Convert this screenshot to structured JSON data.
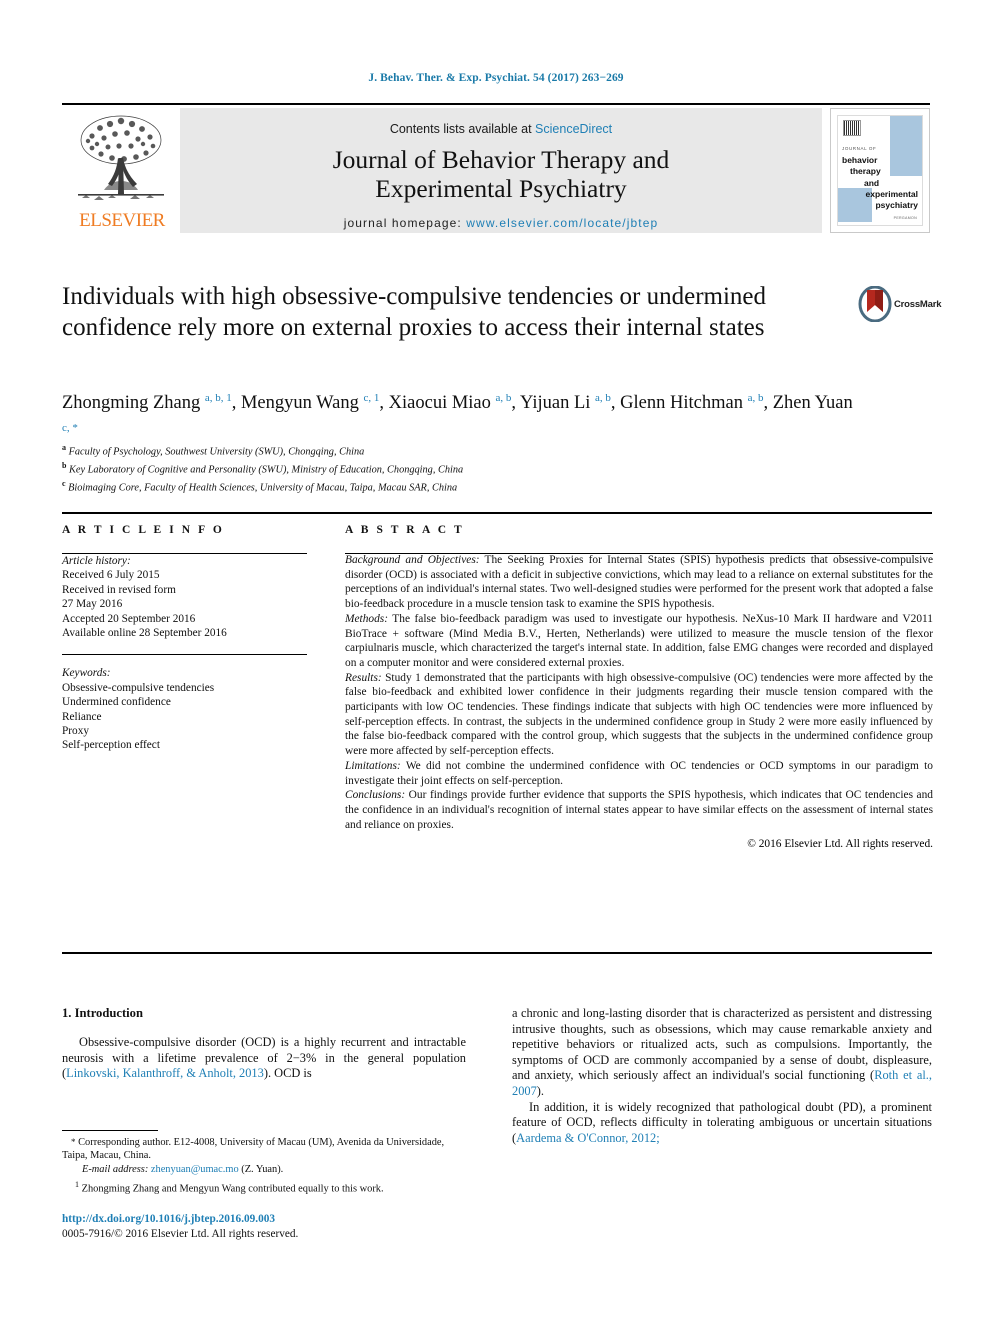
{
  "running_head": "J. Behav. Ther. & Exp. Psychiat. 54 (2017) 263−269",
  "masthead": {
    "contents_prefix": "Contents lists available at ",
    "contents_link": "ScienceDirect",
    "journal_title_line1": "Journal of Behavior Therapy and",
    "journal_title_line2": "Experimental Psychiatry",
    "homepage_prefix": "journal homepage: ",
    "homepage_link": "www.elsevier.com/locate/jbtep",
    "publisher": "ELSEVIER",
    "cover": {
      "journal_of": "JOURNAL OF",
      "line1": "behavior",
      "line2": "therapy",
      "line3": "and",
      "line4": "experimental",
      "line5": "psychiatry",
      "publisher_small": "PERGAMON"
    }
  },
  "article": {
    "title": "Individuals with high obsessive-compulsive tendencies or undermined confidence rely more on external proxies to access their internal states",
    "crossmark_label": "CrossMark",
    "authors": [
      {
        "name": "Zhongming Zhang",
        "marks": "a, b, 1",
        "sep": ", "
      },
      {
        "name": "Mengyun Wang",
        "marks": "c, 1",
        "sep": ", "
      },
      {
        "name": "Xiaocui Miao",
        "marks": "a, b",
        "sep": ", "
      },
      {
        "name": "Yijuan Li",
        "marks": "a, b",
        "sep": ", "
      },
      {
        "name": "Glenn Hitchman",
        "marks": "a, b",
        "sep": ", "
      },
      {
        "name": "Zhen Yuan",
        "marks": "c, *",
        "sep": ""
      }
    ],
    "affiliations": [
      {
        "mark": "a",
        "text": "Faculty of Psychology, Southwest University (SWU), Chongqing, China"
      },
      {
        "mark": "b",
        "text": "Key Laboratory of Cognitive and Personality (SWU), Ministry of Education, Chongqing, China"
      },
      {
        "mark": "c",
        "text": "Bioimaging Core, Faculty of Health Sciences, University of Macau, Taipa, Macau SAR, China"
      }
    ]
  },
  "article_info": {
    "heading": "A R T I C L E  I N F O",
    "history_label": "Article history:",
    "history": [
      "Received 6 July 2015",
      "Received in revised form",
      "27 May 2016",
      "Accepted 20 September 2016",
      "Available online 28 September 2016"
    ],
    "keywords_label": "Keywords:",
    "keywords": [
      "Obsessive-compulsive tendencies",
      "Undermined confidence",
      "Reliance",
      "Proxy",
      "Self-perception effect"
    ]
  },
  "abstract": {
    "heading": "A B S T R A C T",
    "paragraphs": [
      {
        "label": "Background and Objectives:",
        "text": " The Seeking Proxies for Internal States (SPIS) hypothesis predicts that obsessive-compulsive disorder (OCD) is associated with a deficit in subjective convictions, which may lead to a reliance on external substitutes for the perceptions of an individual's internal states. Two well-designed studies were performed for the present work that adopted a false bio-feedback procedure in a muscle tension task to examine the SPIS hypothesis."
      },
      {
        "label": "Methods:",
        "text": " The false bio-feedback paradigm was used to investigate our hypothesis. NeXus-10 Mark II hardware and V2011 BioTrace + software (Mind Media B.V., Herten, Netherlands) were utilized to measure the muscle tension of the flexor carpiulnaris muscle, which characterized the target's internal state. In addition, false EMG changes were recorded and displayed on a computer monitor and were considered external proxies."
      },
      {
        "label": "Results:",
        "text": " Study 1 demonstrated that the participants with high obsessive-compulsive (OC) tendencies were more affected by the false bio-feedback and exhibited lower confidence in their judgments regarding their muscle tension compared with the participants with low OC tendencies. These findings indicate that subjects with high OC tendencies were more influenced by self-perception effects. In contrast, the subjects in the undermined confidence group in Study 2 were more easily influenced by the false bio-feedback compared with the control group, which suggests that the subjects in the undermined confidence group were more affected by self-perception effects."
      },
      {
        "label": "Limitations:",
        "text": " We did not combine the undermined confidence with OC tendencies or OCD symptoms in our paradigm to investigate their joint effects on self-perception."
      },
      {
        "label": "Conclusions:",
        "text": " Our findings provide further evidence that supports the SPIS hypothesis, which indicates that OC tendencies and the confidence in an individual's recognition of internal states appear to have similar effects on the assessment of internal states and reliance on proxies."
      }
    ],
    "copyright": "© 2016 Elsevier Ltd. All rights reserved."
  },
  "introduction": {
    "heading": "1. Introduction",
    "left_p1_a": "Obsessive-compulsive disorder (OCD) is a highly recurrent and intractable neurosis with a lifetime prevalence of 2−3% in the general population (",
    "left_p1_ref": "Linkovski, Kalanthroff, & Anholt, 2013",
    "left_p1_b": "). OCD is",
    "right_p1_a": "a chronic and long-lasting disorder that is characterized as persistent and distressing intrusive thoughts, such as obsessions, which may cause remarkable anxiety and repetitive behaviors or ritualized acts, such as compulsions. Importantly, the symptoms of OCD are commonly accompanied by a sense of doubt, displeasure, and anxiety, which seriously affect an individual's social functioning (",
    "right_p1_ref": "Roth et al., 2007",
    "right_p1_b": ").",
    "right_p2_a": "In addition, it is widely recognized that pathological doubt (PD), a prominent feature of OCD, reflects difficulty in tolerating ambiguous or uncertain situations (",
    "right_p2_ref": "Aardema & O'Connor, 2012;"
  },
  "footnotes": {
    "corresponding": "Corresponding author. E12-4008, University of Macau (UM), Avenida da Universidade, Taipa, Macau, China.",
    "email_label": "E-mail address:",
    "email": "zhenyuan@umac.mo",
    "email_suffix": " (Z. Yuan).",
    "equal_contrib": "Zhongming Zhang and Mengyun Wang contributed equally to this work."
  },
  "footer": {
    "doi": "http://dx.doi.org/10.1016/j.jbtep.2016.09.003",
    "issn": "0005-7916/© 2016 Elsevier Ltd. All rights reserved."
  },
  "colors": {
    "link": "#1f7fb5",
    "masthead_bg": "#e8e8e8",
    "elsevier_orange": "#ef7c23",
    "cover_blue": "#a9c6de"
  }
}
